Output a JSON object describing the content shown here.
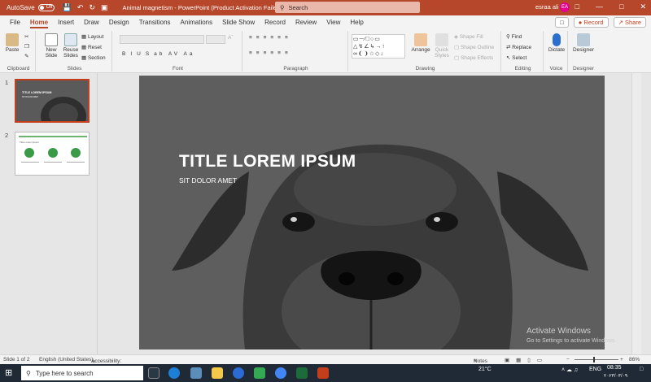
{
  "titlebar": {
    "autosave_label": "AutoSave",
    "autosave_state": "Off",
    "doc_title": "Animal magnetism  -  PowerPoint (Product Activation Failed)",
    "search_placeholder": "Search",
    "user_name": "esraa ali",
    "accent_color": "#b7472a"
  },
  "tabs": [
    "File",
    "Home",
    "Insert",
    "Draw",
    "Design",
    "Transitions",
    "Animations",
    "Slide Show",
    "Record",
    "Review",
    "View",
    "Help"
  ],
  "active_tab": "Home",
  "tab_actions": {
    "record": "Record",
    "share": "Share"
  },
  "ribbon": {
    "clipboard": {
      "label": "Clipboard",
      "paste": "Paste"
    },
    "slides": {
      "label": "Slides",
      "new_slide_1": "New",
      "new_slide_2": "Slide",
      "reuse_1": "Reuse",
      "reuse_2": "Slides",
      "layout": "Layout",
      "reset": "Reset",
      "section": "Section"
    },
    "font": {
      "label": "Font"
    },
    "paragraph": {
      "label": "Paragraph"
    },
    "drawing": {
      "label": "Drawing",
      "arrange": "Arrange",
      "quick_styles_1": "Quick",
      "quick_styles_2": "Styles",
      "shape_fill": "Shape Fill",
      "shape_outline": "Shape Outline",
      "shape_effects": "Shape Effects"
    },
    "editing": {
      "label": "Editing",
      "find": "Find",
      "replace": "Replace",
      "select": "Select"
    },
    "voice": {
      "label": "Voice",
      "dictate": "Dictate"
    },
    "designer": {
      "label": "Designer",
      "designer_btn": "Designer"
    }
  },
  "slides_panel": {
    "slides": [
      {
        "number": "1",
        "title": "TITLE LOREM IPSUM",
        "subtitle": "SIT DOLOR AMET"
      },
      {
        "number": "2",
        "title": "Title Lorem Ipsum"
      }
    ]
  },
  "slide": {
    "title": "TITLE LOREM IPSUM",
    "subtitle": "SIT DOLOR AMET"
  },
  "watermark": {
    "line1": "Activate Windows",
    "line2": "Go to Settings to activate Windows."
  },
  "statusbar": {
    "slide_info": "Slide 1 of 2",
    "language": "English (United States)",
    "accessibility": "Accessibility: Good to go",
    "notes": "Notes",
    "zoom": "86%"
  },
  "taskbar": {
    "search_placeholder": "Type here to search",
    "weather": "21°C",
    "lang": "ENG",
    "time": "08:35",
    "date": "٢٠٢٣/٠٣/٠٩"
  }
}
